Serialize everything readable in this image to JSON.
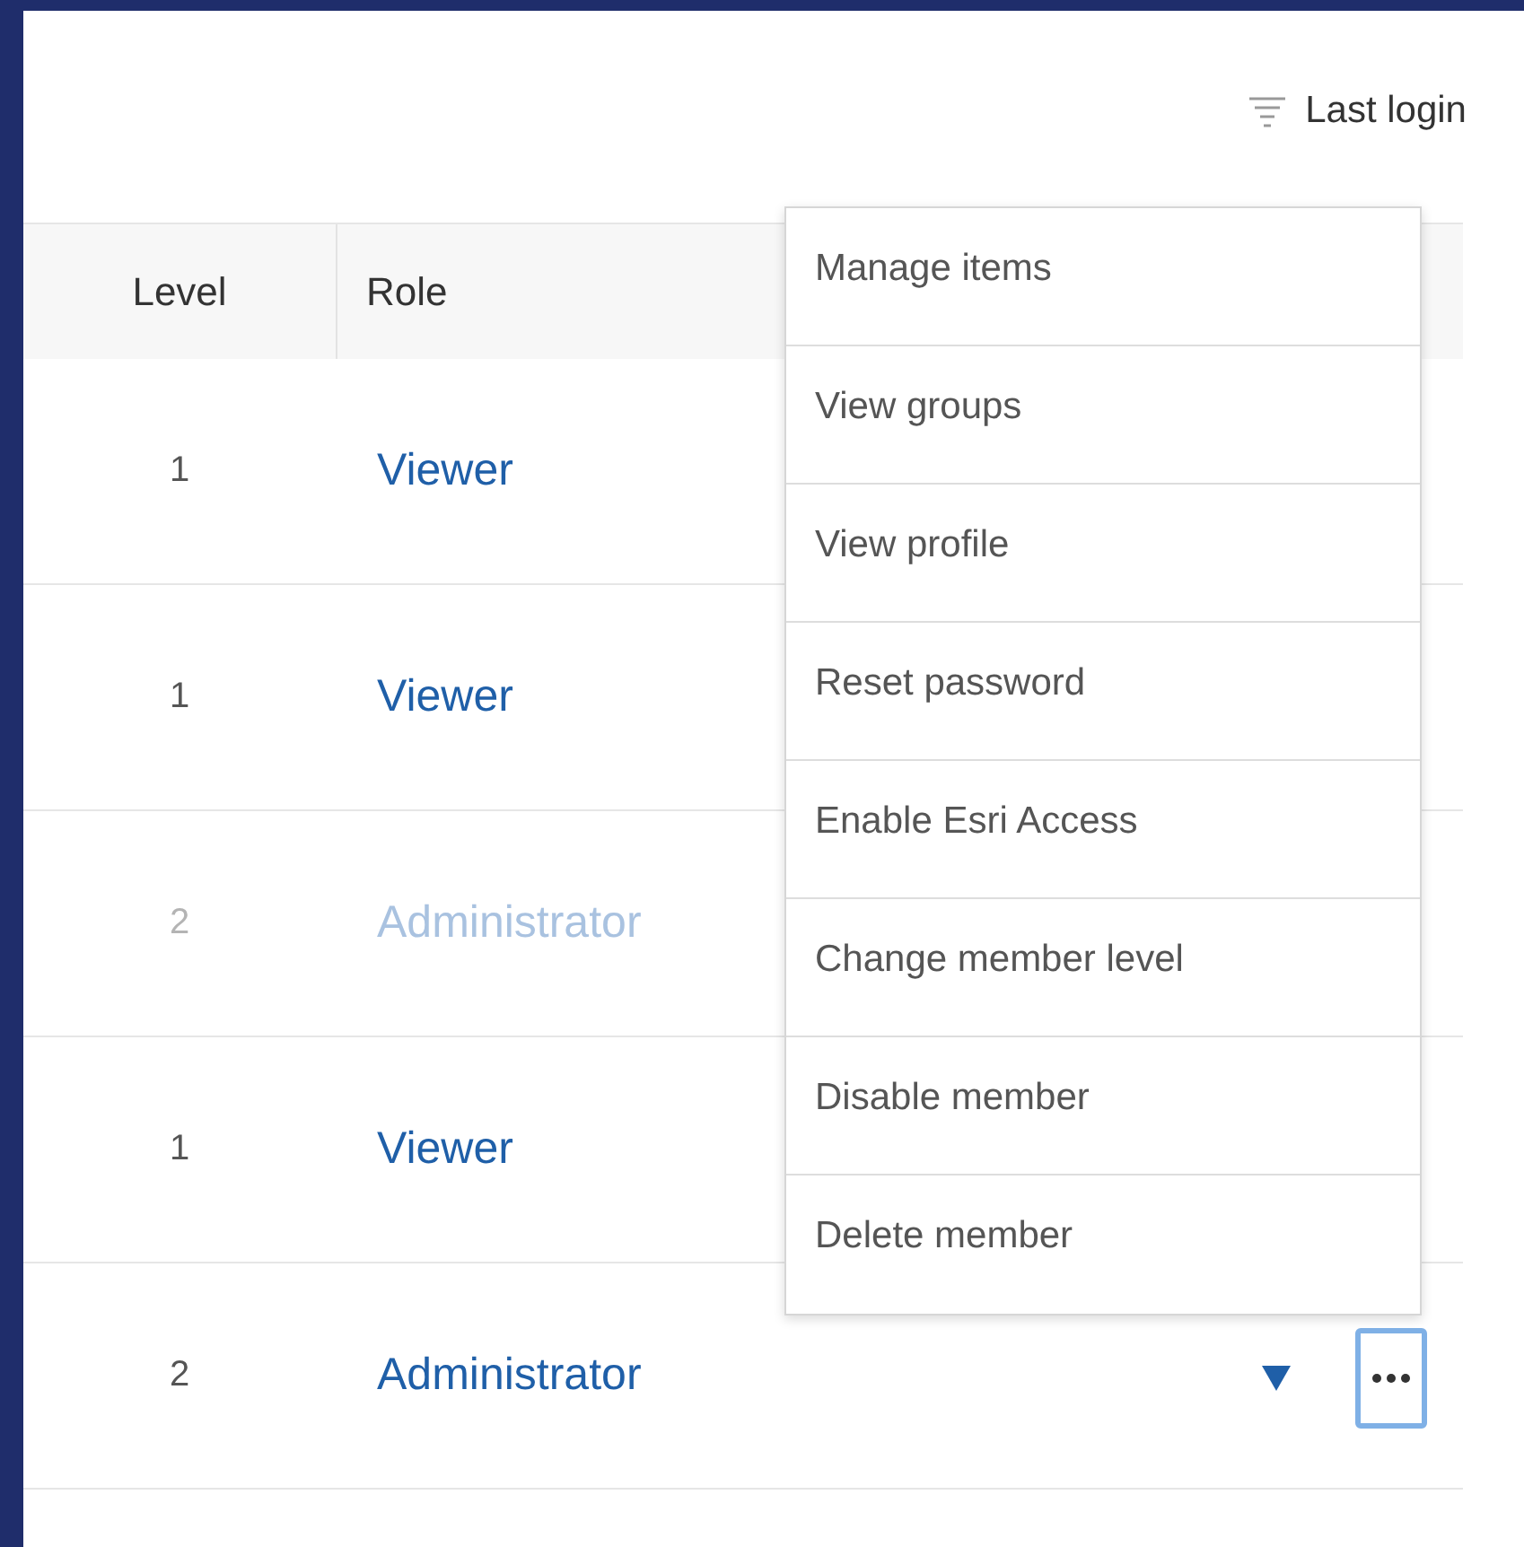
{
  "sort": {
    "label": "Last login"
  },
  "table": {
    "columns": [
      "Level",
      "Role"
    ],
    "rows": [
      {
        "level": "1",
        "role": "Viewer",
        "disabled": false,
        "menu_open": false
      },
      {
        "level": "1",
        "role": "Viewer",
        "disabled": false,
        "menu_open": false
      },
      {
        "level": "2",
        "role": "Administrator",
        "disabled": true,
        "menu_open": false
      },
      {
        "level": "1",
        "role": "Viewer",
        "disabled": false,
        "menu_open": false
      },
      {
        "level": "2",
        "role": "Administrator",
        "disabled": false,
        "menu_open": true
      }
    ]
  },
  "menu": {
    "items": [
      "Manage items",
      "View groups",
      "View profile",
      "Reset password",
      "Enable Esri Access",
      "Change member level",
      "Disable member",
      "Delete member"
    ]
  }
}
